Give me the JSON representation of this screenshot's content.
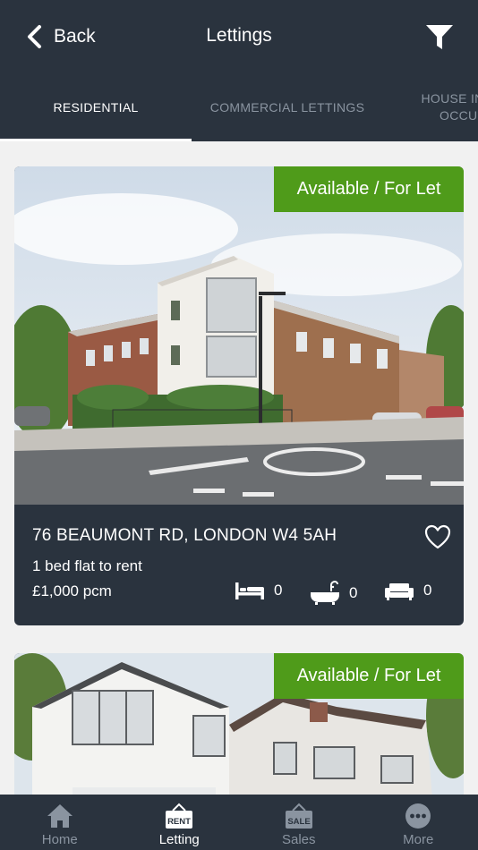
{
  "header": {
    "back_label": "Back",
    "title": "Lettings"
  },
  "tabs": [
    {
      "label": "RESIDENTIAL",
      "active": true
    },
    {
      "label": "COMMERCIAL LETTINGS",
      "active": false
    },
    {
      "label": "HOUSE IN OCCUP",
      "line1": "HOUSE IN",
      "line2": "OCCUP",
      "active": false
    }
  ],
  "listings": [
    {
      "status": "Available / For Let",
      "address": "76 BEAUMONT RD, LONDON W4 5AH",
      "description": "1 bed flat to rent",
      "price": "£1,000 pcm",
      "bedrooms": "0",
      "bathrooms": "0",
      "receptions": "0"
    },
    {
      "status": "Available / For Let"
    }
  ],
  "bottom_nav": [
    {
      "label": "Home",
      "icon": "home-icon"
    },
    {
      "label": "Letting",
      "icon": "rent-sign-icon",
      "icon_text": "RENT",
      "active": true
    },
    {
      "label": "Sales",
      "icon": "sale-sign-icon",
      "icon_text": "SALE"
    },
    {
      "label": "More",
      "icon": "more-icon"
    }
  ],
  "colors": {
    "header_bg": "#2a333e",
    "badge_green": "#4f9b1a",
    "inactive_text": "#8a94a0"
  }
}
